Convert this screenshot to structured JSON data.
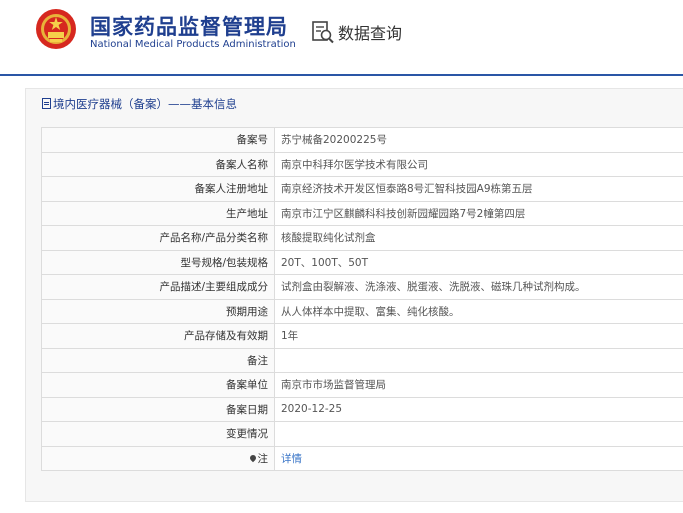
{
  "header": {
    "agency_cn": "国家药品监督管理局",
    "agency_en": "National Medical Products Administration",
    "query_label": "数据查询",
    "accent_color": "#1f3f8f",
    "line_color": "#2a56a6"
  },
  "panel": {
    "title": "境内医疗器械（备案）——基本信息"
  },
  "rows": [
    {
      "label": "备案号",
      "value": "苏宁械备20200225号"
    },
    {
      "label": "备案人名称",
      "value": "南京中科拜尔医学技术有限公司"
    },
    {
      "label": "备案人注册地址",
      "value": "南京经济技术开发区恒泰路8号汇智科技园A9栋第五层"
    },
    {
      "label": "生产地址",
      "value": "南京市江宁区麒麟科科技创新园耀园路7号2幢第四层"
    },
    {
      "label": "产品名称/产品分类名称",
      "value": "核酸提取纯化试剂盒"
    },
    {
      "label": "型号规格/包装规格",
      "value": "20T、100T、50T"
    },
    {
      "label": "产品描述/主要组成成分",
      "value": "试剂盒由裂解液、洗涤液、脱蛋液、洗脱液、磁珠几种试剂构成。"
    },
    {
      "label": "预期用途",
      "value": "从人体样本中提取、富集、纯化核酸。"
    },
    {
      "label": "产品存储及有效期",
      "value": "1年"
    },
    {
      "label": "备注",
      "value": ""
    },
    {
      "label": "备案单位",
      "value": "南京市市场监督管理局"
    },
    {
      "label": "备案日期",
      "value": "2020-12-25"
    },
    {
      "label": "变更情况",
      "value": ""
    },
    {
      "label": "注",
      "value": "详情"
    }
  ]
}
